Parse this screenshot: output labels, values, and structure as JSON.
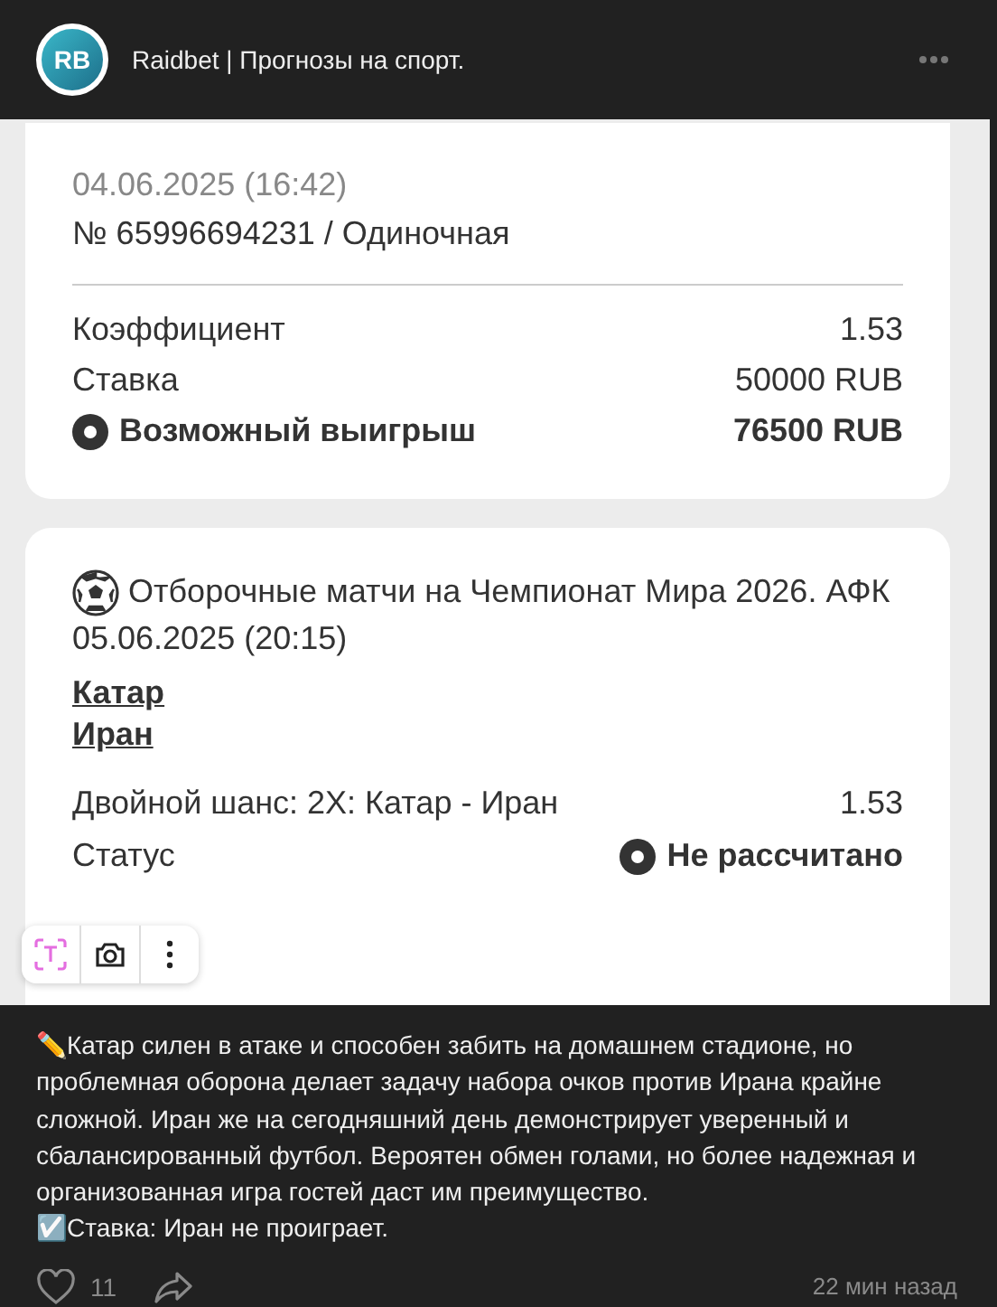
{
  "header": {
    "title": "Raidbet | Прогнозы на спорт.",
    "avatar_text": "RB"
  },
  "bet_card": {
    "datetime": "04.06.2025 (16:42)",
    "number": "№ 65996694231 / Одиночная",
    "rows": [
      {
        "label": "Коэффициент",
        "value": "1.53",
        "kind": "plain"
      },
      {
        "label": "Ставка",
        "value": "50000 RUB",
        "kind": "plain"
      },
      {
        "label": "Возможный выигрыш",
        "value": "76500 RUB",
        "kind": "total"
      }
    ]
  },
  "event_card": {
    "tournament": "Отборочные матчи на Чемпионат Мира 2026. АФК",
    "datetime": "05.06.2025 (20:15)",
    "teams": [
      "Катар",
      "Иран"
    ],
    "market": "Двойной шанс: 2X: Катар - Иран",
    "odds": "1.53",
    "status_label": "Статус",
    "status": "Не рассчитано"
  },
  "post": {
    "paragraphs": [
      "✏️Катар силен в атаке и способен забить на домашнем стадионе, но проблемная оборона делает задачу набора очков против Ирана крайне сложной. Иран же на сегодняшний день демонстрирует уверенный и сбалансированный футбол. Вероятен обмен голами, но более надежная и организованная игра гостей даст им преимущество.",
      "☑️Ставка: Иран не проиграет."
    ],
    "likes": "11",
    "liked": false,
    "time": "22 мин назад"
  }
}
